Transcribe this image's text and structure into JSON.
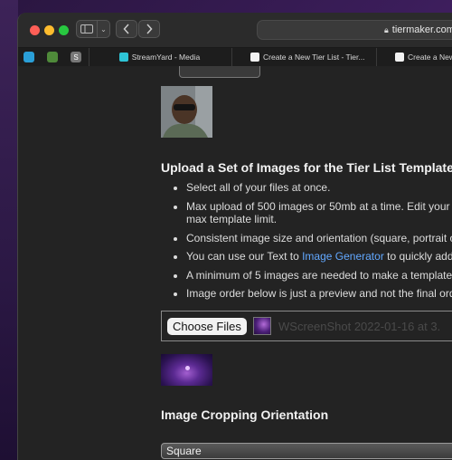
{
  "browser": {
    "address": "tiermaker.com",
    "tabs": [
      {
        "label": "StreamYard - Media"
      },
      {
        "label": "Create a New Tier List - Tier..."
      },
      {
        "label": "Create a New"
      }
    ]
  },
  "page": {
    "upload_heading": "Upload a Set of Images for the Tier List Template",
    "bullets": [
      {
        "text": "Select all of your files at once."
      },
      {
        "text": "Max upload of 500 images or 50mb at a time. Edit your",
        "cont": "max template limit."
      },
      {
        "text": "Consistent image size and orientation (square, portrait or"
      },
      {
        "text_before": "You can use our Text to ",
        "link": "Image Generator",
        "text_after": " to quickly add"
      },
      {
        "text": "A minimum of 5 images are needed to make a template"
      },
      {
        "text": "Image order below is just a preview and not the final order"
      }
    ],
    "choose_files_label": "Choose Files",
    "selected_file": "WScreenShot 2022-01-16 at 3.",
    "crop_heading": "Image Cropping Orientation",
    "crop_value": "Square"
  }
}
